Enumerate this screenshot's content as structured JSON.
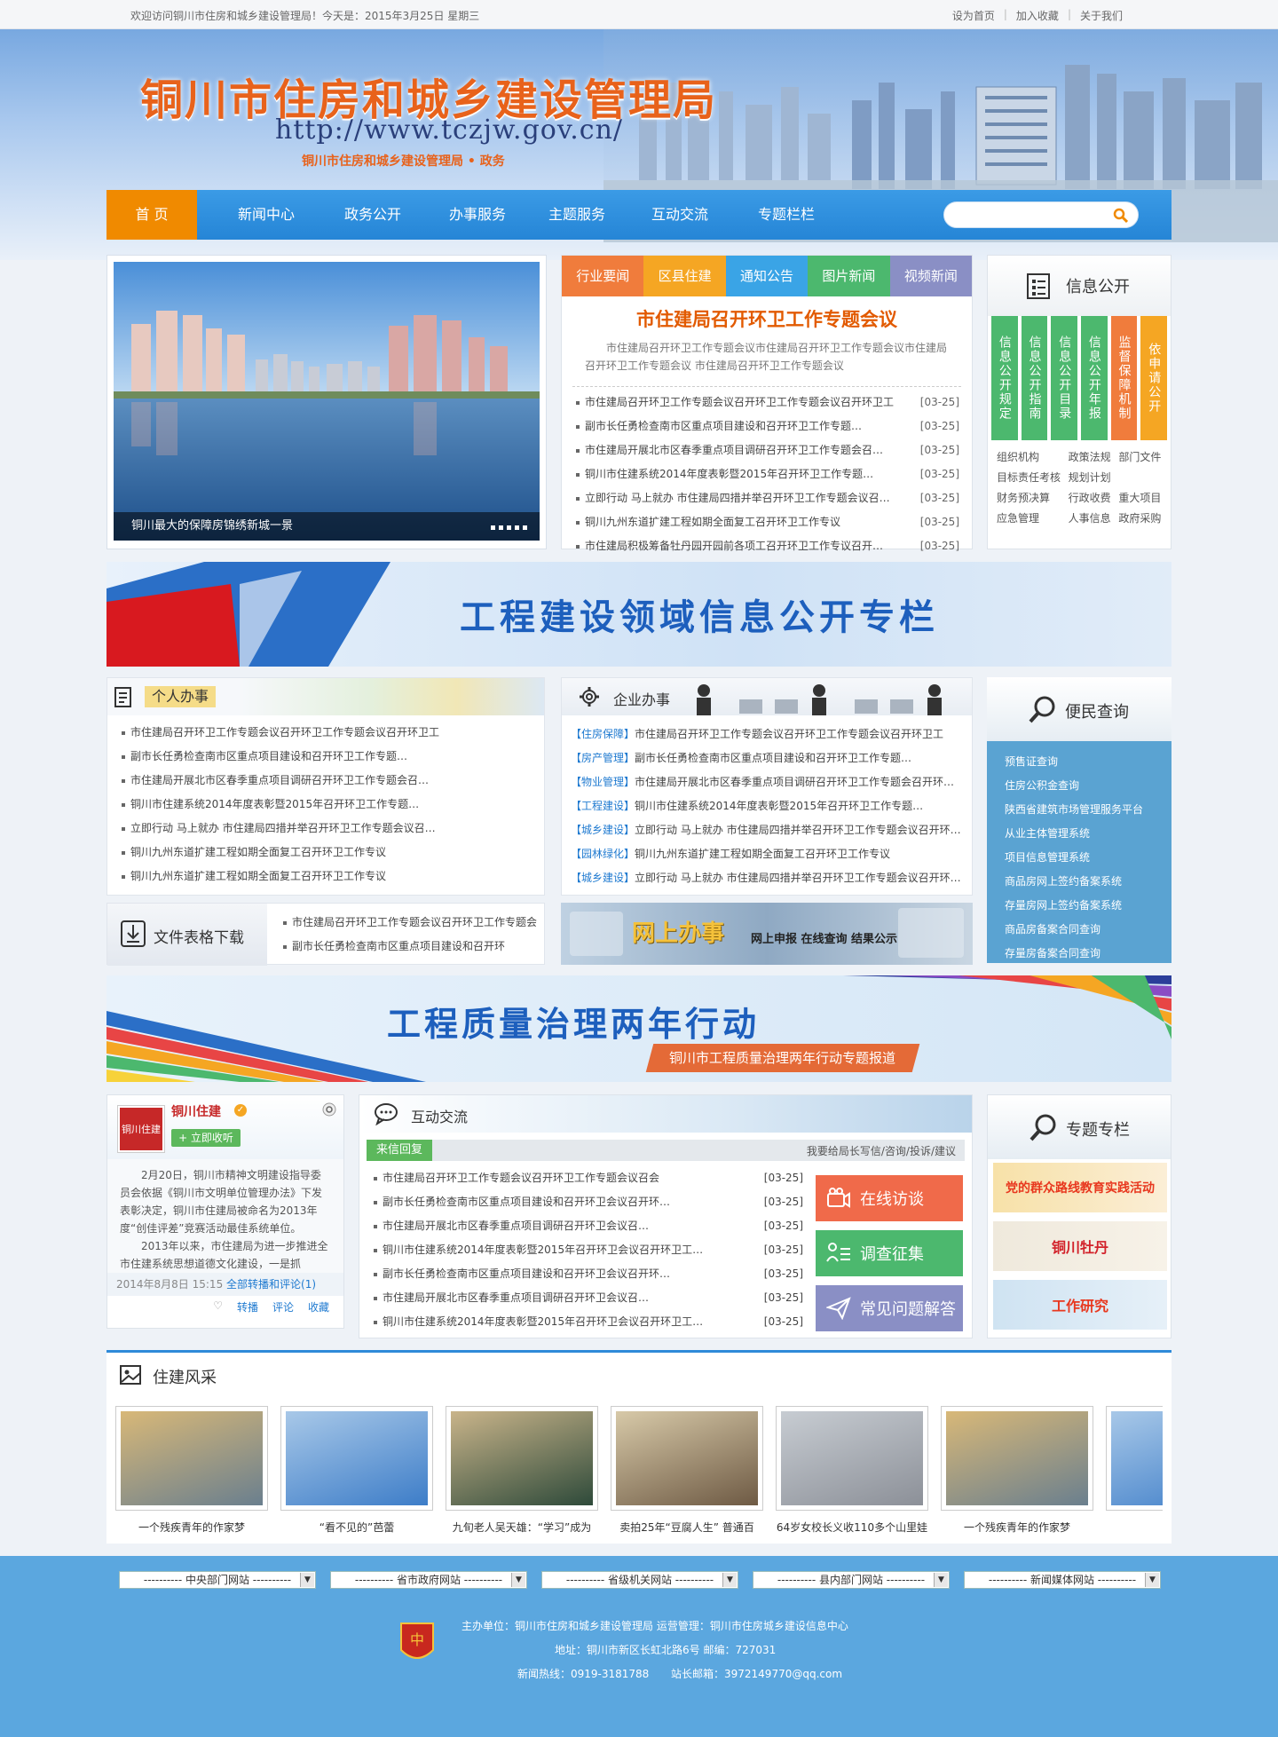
{
  "topbar": {
    "welcome": "欢迎访问铜川市住房和城乡建设管理局！今天是：2015年3月25日 星期三",
    "links": [
      "设为首页",
      "加入收藏",
      "关于我们"
    ]
  },
  "header": {
    "title": "铜川市住房和城乡建设管理局",
    "url": "http://www.tczjw.gov.cn/",
    "slogan": "铜川市住房和城乡建设管理局 • 政务"
  },
  "nav": {
    "items": [
      "首  页",
      "新闻中心",
      "政务公开",
      "办事服务",
      "主题服务",
      "互动交流",
      "专题栏栏"
    ],
    "search_placeholder": ""
  },
  "slideshow": {
    "caption": "铜川最大的保障房锦绣新城一景"
  },
  "news": {
    "tabs": [
      {
        "label": "行业要闻",
        "color": "#f07c3c"
      },
      {
        "label": "区县住建",
        "color": "#f5a623"
      },
      {
        "label": "通知公告",
        "color": "#3aa4e6"
      },
      {
        "label": "图片新闻",
        "color": "#4cb86e"
      },
      {
        "label": "视频新闻",
        "color": "#8a8fc5"
      }
    ],
    "headline": "市住建局召开环卫工作专题会议",
    "summary": "市住建局召开环卫工作专题会议市住建局召开环卫工作专题会议市住建局召开环卫工作专题会议 市住建局召开环卫工作专题会议",
    "items": [
      {
        "title": "市住建局召开环卫工作专题会议召开环卫工作专题会议召开环卫工",
        "date": "[03-25]"
      },
      {
        "title": "副市长任勇检查南市区重点项目建设和召开环卫工作专题…",
        "date": "[03-25]"
      },
      {
        "title": "市住建局开展北市区春季重点项目调研召开环卫工作专题会召开环卫…",
        "date": "[03-25]"
      },
      {
        "title": "铜川市住建系统2014年度表彰暨2015年召开环卫工作专题…",
        "date": "[03-25]"
      },
      {
        "title": "立即行动 马上就办 市住建局四措并举召开环卫工作专题会议召开环…",
        "date": "[03-25]"
      },
      {
        "title": "铜川九州东道扩建工程如期全面复工召开环卫工作专议",
        "date": "[03-25]"
      },
      {
        "title": "市住建局积极筹备牡丹园开园前各项工召开环卫工作专议召开环作…",
        "date": "[03-25]"
      }
    ]
  },
  "info_open": {
    "title": "信息公开",
    "columns": [
      {
        "label": "信息公开规定",
        "color": "#4cb86e"
      },
      {
        "label": "信息公开指南",
        "color": "#4cb86e"
      },
      {
        "label": "信息公开目录",
        "color": "#4cb86e"
      },
      {
        "label": "信息公开年报",
        "color": "#4cb86e"
      },
      {
        "label": "监督保障机制",
        "color": "#f07c3c"
      },
      {
        "label": "依申请公开",
        "color": "#f5a623"
      }
    ],
    "links": [
      "组织机构",
      "政策法规",
      "部门文件",
      "目标责任考核",
      "规划计划",
      "",
      "财务预决算",
      "行政收费",
      "重大项目",
      "应急管理",
      "人事信息",
      "政府采购"
    ]
  },
  "banner1": {
    "text": "工程建设领域信息公开专栏"
  },
  "personal": {
    "title": "个人办事",
    "items": [
      "市住建局召开环卫工作专题会议召开环卫工作专题会议召开环卫工",
      "副市长任勇检查南市区重点项目建设和召开环卫工作专题…",
      "市住建局开展北市区春季重点项目调研召开环卫工作专题会召开环卫…",
      "铜川市住建系统2014年度表彰暨2015年召开环卫工作专题…",
      "立即行动 马上就办 市住建局四措并举召开环卫工作专题会议召开环…",
      "铜川九州东道扩建工程如期全面复工召开环卫工作专议",
      "铜川九州东道扩建工程如期全面复工召开环卫工作专议"
    ]
  },
  "enterprise": {
    "title": "企业办事",
    "items": [
      {
        "tag": "【住房保障】",
        "text": "市住建局召开环卫工作专题会议召开环卫工作专题会议召开环卫工"
      },
      {
        "tag": "【房产管理】",
        "text": "副市长任勇检查南市区重点项目建设和召开环卫工作专题…"
      },
      {
        "tag": "【物业管理】",
        "text": "市住建局开展北市区春季重点项目调研召开环卫工作专题会召开环卫…"
      },
      {
        "tag": "【工程建设】",
        "text": "铜川市住建系统2014年度表彰暨2015年召开环卫工作专题…"
      },
      {
        "tag": "【城乡建设】",
        "text": "立即行动 马上就办 市住建局四措并举召开环卫工作专题会议召开环…"
      },
      {
        "tag": "【园林绿化】",
        "text": "铜川九州东道扩建工程如期全面复工召开环卫工作专议"
      },
      {
        "tag": "【城乡建设】",
        "text": "立即行动 马上就办 市住建局四措并举召开环卫工作专题会议召开环…"
      }
    ]
  },
  "convenience": {
    "title": "便民查询",
    "items": [
      "预售证查询",
      "住房公积金查询",
      "陕西省建筑市场管理服务平台",
      "从业主体管理系统",
      "项目信息管理系统",
      "商品房网上签约备案系统",
      "存量房网上签约备案系统",
      "商品房备案合同查询",
      "存量房备案合同查询"
    ]
  },
  "downloads": {
    "title": "文件表格下载",
    "items": [
      "市住建局召开环卫工作专题会议召开环卫工作专题会",
      "副市长任勇检查南市区重点项目建设和召开环"
    ]
  },
  "online": {
    "title": "网上办事",
    "sub": "网上申报  在线查询  结果公示"
  },
  "banner2": {
    "text": "工程质量治理两年行动",
    "sub": "铜川市工程质量治理两年行动专题报道"
  },
  "weibo": {
    "name": "铜川住建",
    "logo": "铜川住建",
    "follow": "+ 立即收听",
    "body1": "2月20日，铜川市精神文明建设指导委员会依据《铜川市文明单位管理办法》下发表彰决定，铜川市住建局被命名为2013年度“创佳评差”竞赛活动最佳系统单位。",
    "body2": "2013年以来，市住建局为进一步推进全市住建系统思想道德文化建设，一是抓",
    "time": "2014年8月8日 15:15",
    "link": "全部转播和评论(1)",
    "actions": [
      "转播",
      "评论",
      "收藏"
    ]
  },
  "interact": {
    "title": "互动交流",
    "reply": "来信回复",
    "right": "我要给局长写信/咨询/投诉/建议",
    "items": [
      {
        "title": "市住建局召开环卫工作专题会议召开环卫工作专题会议召会",
        "date": "[03-25]"
      },
      {
        "title": "副市长任勇检查南市区重点项目建设和召开环卫会议召开环…",
        "date": "[03-25]"
      },
      {
        "title": "市住建局开展北市区春季重点项目调研召开环卫会议召…",
        "date": "[03-25]"
      },
      {
        "title": "铜川市住建系统2014年度表彰暨2015年召开环卫会议召开环卫工…",
        "date": "[03-25]"
      },
      {
        "title": "副市长任勇检查南市区重点项目建设和召开环卫会议召开环…",
        "date": "[03-25]"
      },
      {
        "title": "市住建局开展北市区春季重点项目调研召开环卫会议召…",
        "date": "[03-25]"
      },
      {
        "title": "铜川市住建系统2014年度表彰暨2015年召开环卫会议召开环卫工…",
        "date": "[03-25]"
      }
    ],
    "buttons": [
      {
        "label": "在线访谈",
        "color": "#f06a4a"
      },
      {
        "label": "调查征集",
        "color": "#4cb86e"
      },
      {
        "label": "常见问题解答",
        "color": "#8a8fc5"
      }
    ]
  },
  "special": {
    "title": "专题专栏",
    "banners": [
      {
        "label": "党的群众路线教育实践活动",
        "color": "#e8381f"
      },
      {
        "label": "铜川牡丹",
        "color": "#d2222a"
      },
      {
        "label": "工作研究",
        "color": "#e8381f"
      }
    ]
  },
  "gallery": {
    "title": "住建风采",
    "items": [
      "一个残疾青年的作家梦",
      "“看不见的”芭蕾",
      "九旬老人吴天雄：“学习”成为",
      "卖拍25年“豆腐人生” 普通百",
      "64岁女校长义收110多个山里娃",
      "一个残疾青年的作家梦",
      "“看"
    ]
  },
  "footer": {
    "selects": [
      "---------- 中央部门网站 ----------",
      "---------- 省市政府网站 ----------",
      "---------- 省级机关网站 ----------",
      "---------- 县内部门网站 ----------",
      "---------- 新闻媒体网站 ----------"
    ],
    "line1": "主办单位：铜川市住房和城乡建设管理局   运营管理：铜川市住房城乡建设信息中心",
    "line2": "地址：铜川市新区长虹北路6号  邮编：727031",
    "line3a": "新闻热线：0919-3181788",
    "line3b": "站长邮箱：3972149770@qq.com"
  }
}
